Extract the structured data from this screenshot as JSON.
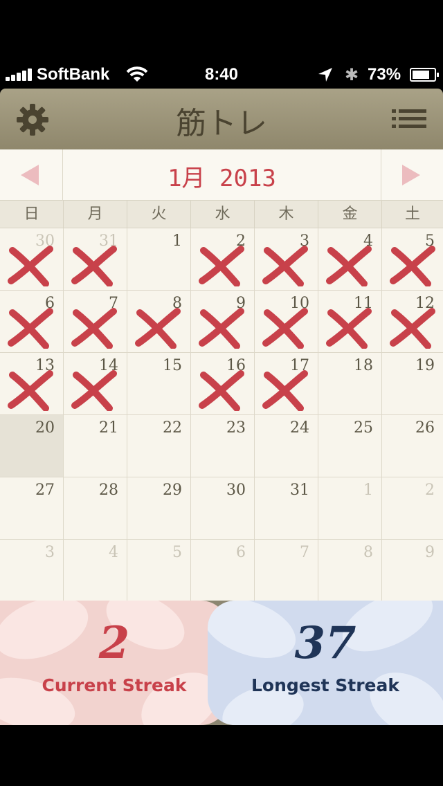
{
  "status_bar": {
    "carrier": "SoftBank",
    "time": "8:40",
    "battery": "73%",
    "battery_level": 0.73
  },
  "header": {
    "title": "筋トレ"
  },
  "calendar": {
    "month_label": "1月 2013",
    "weekdays": [
      "日",
      "月",
      "火",
      "水",
      "木",
      "金",
      "土"
    ],
    "weeks": [
      [
        {
          "d": "30",
          "o": true,
          "x": true
        },
        {
          "d": "31",
          "o": true,
          "x": true
        },
        {
          "d": "1",
          "o": false,
          "x": false
        },
        {
          "d": "2",
          "o": false,
          "x": true
        },
        {
          "d": "3",
          "o": false,
          "x": true
        },
        {
          "d": "4",
          "o": false,
          "x": true
        },
        {
          "d": "5",
          "o": false,
          "x": true
        }
      ],
      [
        {
          "d": "6",
          "o": false,
          "x": true
        },
        {
          "d": "7",
          "o": false,
          "x": true
        },
        {
          "d": "8",
          "o": false,
          "x": true
        },
        {
          "d": "9",
          "o": false,
          "x": true
        },
        {
          "d": "10",
          "o": false,
          "x": true
        },
        {
          "d": "11",
          "o": false,
          "x": true
        },
        {
          "d": "12",
          "o": false,
          "x": true
        }
      ],
      [
        {
          "d": "13",
          "o": false,
          "x": true
        },
        {
          "d": "14",
          "o": false,
          "x": true
        },
        {
          "d": "15",
          "o": false,
          "x": false
        },
        {
          "d": "16",
          "o": false,
          "x": true
        },
        {
          "d": "17",
          "o": false,
          "x": true
        },
        {
          "d": "18",
          "o": false,
          "x": false
        },
        {
          "d": "19",
          "o": false,
          "x": false
        }
      ],
      [
        {
          "d": "20",
          "o": false,
          "x": false,
          "today": true
        },
        {
          "d": "21",
          "o": false,
          "x": false
        },
        {
          "d": "22",
          "o": false,
          "x": false
        },
        {
          "d": "23",
          "o": false,
          "x": false
        },
        {
          "d": "24",
          "o": false,
          "x": false
        },
        {
          "d": "25",
          "o": false,
          "x": false
        },
        {
          "d": "26",
          "o": false,
          "x": false
        }
      ],
      [
        {
          "d": "27",
          "o": false,
          "x": false
        },
        {
          "d": "28",
          "o": false,
          "x": false
        },
        {
          "d": "29",
          "o": false,
          "x": false
        },
        {
          "d": "30",
          "o": false,
          "x": false
        },
        {
          "d": "31",
          "o": false,
          "x": false
        },
        {
          "d": "1",
          "o": true,
          "x": false
        },
        {
          "d": "2",
          "o": true,
          "x": false
        }
      ],
      [
        {
          "d": "3",
          "o": true,
          "x": false
        },
        {
          "d": "4",
          "o": true,
          "x": false
        },
        {
          "d": "5",
          "o": true,
          "x": false
        },
        {
          "d": "6",
          "o": true,
          "x": false
        },
        {
          "d": "7",
          "o": true,
          "x": false
        },
        {
          "d": "8",
          "o": true,
          "x": false
        },
        {
          "d": "9",
          "o": true,
          "x": false
        }
      ]
    ]
  },
  "streaks": {
    "current": {
      "value": "2",
      "label": "Current Streak"
    },
    "longest": {
      "value": "37",
      "label": "Longest Streak"
    }
  },
  "colors": {
    "accent_red": "#c8414a",
    "navy": "#1f3457",
    "header_khaki": "#9d967a"
  }
}
